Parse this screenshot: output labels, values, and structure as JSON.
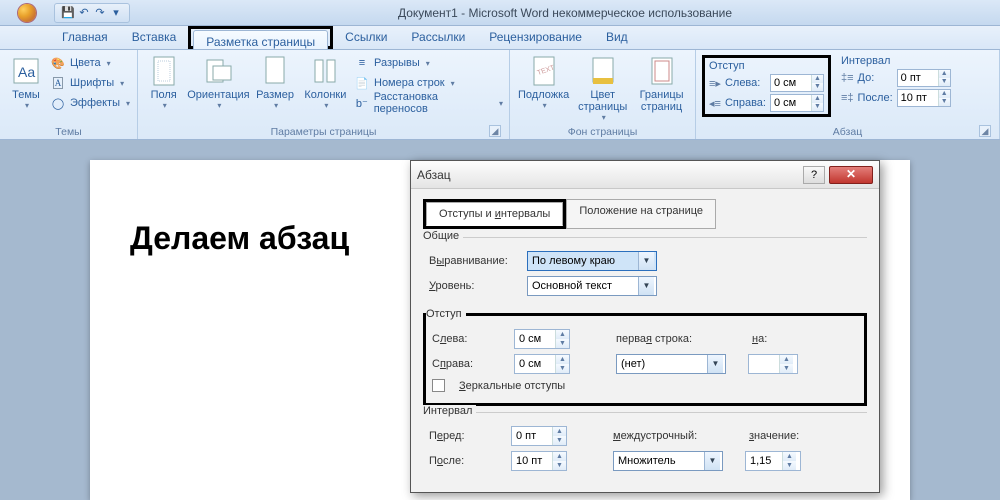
{
  "title": "Документ1 - Microsoft Word некоммерческое использование",
  "tabs": {
    "home": "Главная",
    "insert": "Вставка",
    "pagelayout": "Разметка страницы",
    "references": "Ссылки",
    "mailings": "Рассылки",
    "review": "Рецензирование",
    "view": "Вид"
  },
  "ribbon": {
    "themes": {
      "label": "Темы",
      "btn": "Темы",
      "colors": "Цвета",
      "fonts": "Шрифты",
      "effects": "Эффекты"
    },
    "page_setup": {
      "label": "Параметры страницы",
      "margins": "Поля",
      "orientation": "Ориентация",
      "size": "Размер",
      "columns": "Колонки",
      "breaks": "Разрывы",
      "line_numbers": "Номера строк",
      "hyphenation": "Расстановка переносов"
    },
    "page_bg": {
      "label": "Фон страницы",
      "watermark": "Подложка",
      "page_color": "Цвет\nстраницы",
      "borders": "Границы\nстраниц"
    },
    "paragraph": {
      "label": "Абзац",
      "indent_heading": "Отступ",
      "left_label": "Слева:",
      "right_label": "Справа:",
      "left_val": "0 см",
      "right_val": "0 см",
      "spacing_heading": "Интервал",
      "before_label": "До:",
      "after_label": "После:",
      "before_val": "0 пт",
      "after_val": "10 пт"
    }
  },
  "document_text": "Делаем абзац",
  "dialog": {
    "title": "Абзац",
    "tab1": "Отступы и интервалы",
    "tab2": "Положение на странице",
    "general": {
      "legend": "Общие",
      "align_label": "Выравнивание:",
      "align_val": "По левому краю",
      "level_label": "Уровень:",
      "level_val": "Основной текст"
    },
    "indent": {
      "legend": "Отступ",
      "left_label": "Слева:",
      "left_val": "0 см",
      "right_label": "Справа:",
      "right_val": "0 см",
      "first_line_label": "первая строка:",
      "first_line_val": "(нет)",
      "by_label": "на:",
      "mirror": "Зеркальные отступы"
    },
    "spacing": {
      "legend": "Интервал",
      "before_label": "Перед:",
      "before_val": "0 пт",
      "after_label": "После:",
      "after_val": "10 пт",
      "line_label": "междустрочный:",
      "line_val": "Множитель",
      "at_label": "значение:",
      "at_val": "1,15"
    }
  }
}
